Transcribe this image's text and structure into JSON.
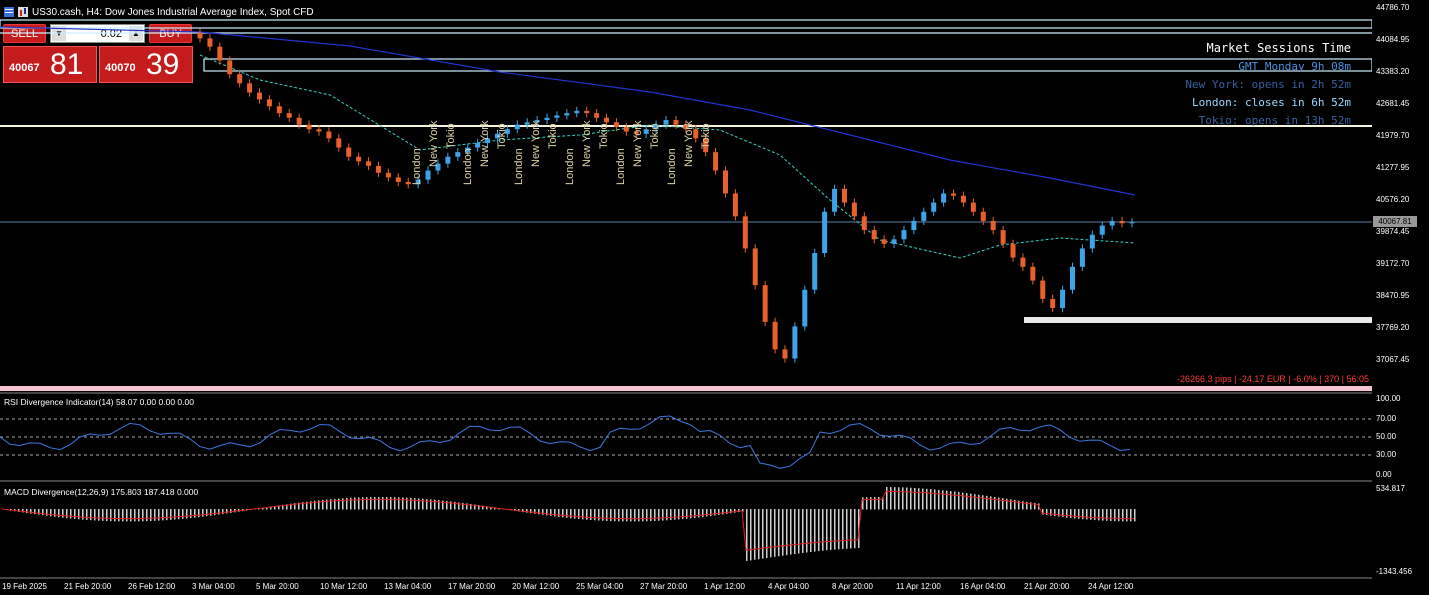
{
  "window": {
    "title": "US30.cash, H4:  Dow Jones Industrial Average Index, Spot CFD"
  },
  "trade_panel": {
    "sell_label": "SELL",
    "buy_label": "BUY",
    "lot": "0.02",
    "sell_small": "40067",
    "sell_big": "81",
    "buy_small": "40070",
    "buy_big": "39",
    "color": "#c41c1c"
  },
  "sessions": {
    "title": "Market Sessions Time",
    "gmt": "GMT Monday 9h 08m",
    "newyork": "New York: opens in 2h 52m",
    "london": "London: closes in 6h 52m",
    "tokio": "Tokio: opens in 13h 52m"
  },
  "price_axis": [
    "44786.70",
    "44084.95",
    "43383.20",
    "42681.45",
    "41979.70",
    "41277.95",
    "40576.20",
    "39874.45",
    "39172.70",
    "38470.95",
    "37769.20",
    "37067.45"
  ],
  "current_price": "40067.81",
  "pips_info": "-26266.3 pips | -24.17 EUR | -6.0% | 370 | 56:05",
  "rsi": {
    "title": "RSI Divergence Indicator(14) 58.07 0.00 0.00 0.00",
    "levels": [
      "100.00",
      "70.00",
      "50.00",
      "30.00",
      "0.00"
    ]
  },
  "macd": {
    "title": "MACD Divergence(12,26,9) 175.803 187.418 0.000",
    "levels": [
      "534.817",
      "-1343.456"
    ]
  },
  "time_axis": [
    "19 Feb 2025",
    "21 Feb 20:00",
    "26 Feb 12:00",
    "3 Mar 04:00",
    "5 Mar 20:00",
    "10 Mar 12:00",
    "13 Mar 04:00",
    "17 Mar 20:00",
    "20 Mar 12:00",
    "25 Mar 04:00",
    "27 Mar 20:00",
    "1 Apr 12:00",
    "4 Apr 04:00",
    "8 Apr 20:00",
    "11 Apr 12:00",
    "16 Apr 04:00",
    "21 Apr 20:00",
    "24 Apr 12:00"
  ],
  "session_labels": [
    "London",
    "New York",
    "Tokio",
    "London",
    "New York",
    "Tokio",
    "London",
    "New York",
    "Tokio",
    "London",
    "New York",
    "Tokio",
    "London",
    "New York",
    "Tokio",
    "London",
    "New York",
    "Tokio"
  ],
  "chart_data": {
    "type": "candlestick",
    "symbol": "US30.cash",
    "timeframe": "H4",
    "ylim": [
      37067.45,
      44786.7
    ],
    "closes": [
      44080,
      43900,
      43600,
      43300,
      43100,
      42900,
      42750,
      42600,
      42450,
      42350,
      42200,
      42100,
      42050,
      41900,
      41700,
      41500,
      41400,
      41300,
      41150,
      41050,
      40950,
      40900,
      41000,
      41200,
      41350,
      41500,
      41600,
      41700,
      41800,
      41900,
      42000,
      42100,
      42200,
      42250,
      42300,
      42350,
      42400,
      42450,
      42500,
      42450,
      42350,
      42250,
      42150,
      42050,
      42000,
      42100,
      42200,
      42300,
      42200,
      42100,
      41900,
      41600,
      41200,
      40700,
      40200,
      39500,
      38700,
      37900,
      37300,
      37100,
      37800,
      38600,
      39400,
      40300,
      40800,
      40500,
      40200,
      39900,
      39700,
      39600,
      39700,
      39900,
      40100,
      40300,
      40500,
      40700,
      40650,
      40500,
      40300,
      40100,
      39900,
      39600,
      39300,
      39100,
      38800,
      38400,
      38200,
      38600,
      39100,
      39500,
      39800,
      40000,
      40100,
      40050,
      40070
    ]
  }
}
